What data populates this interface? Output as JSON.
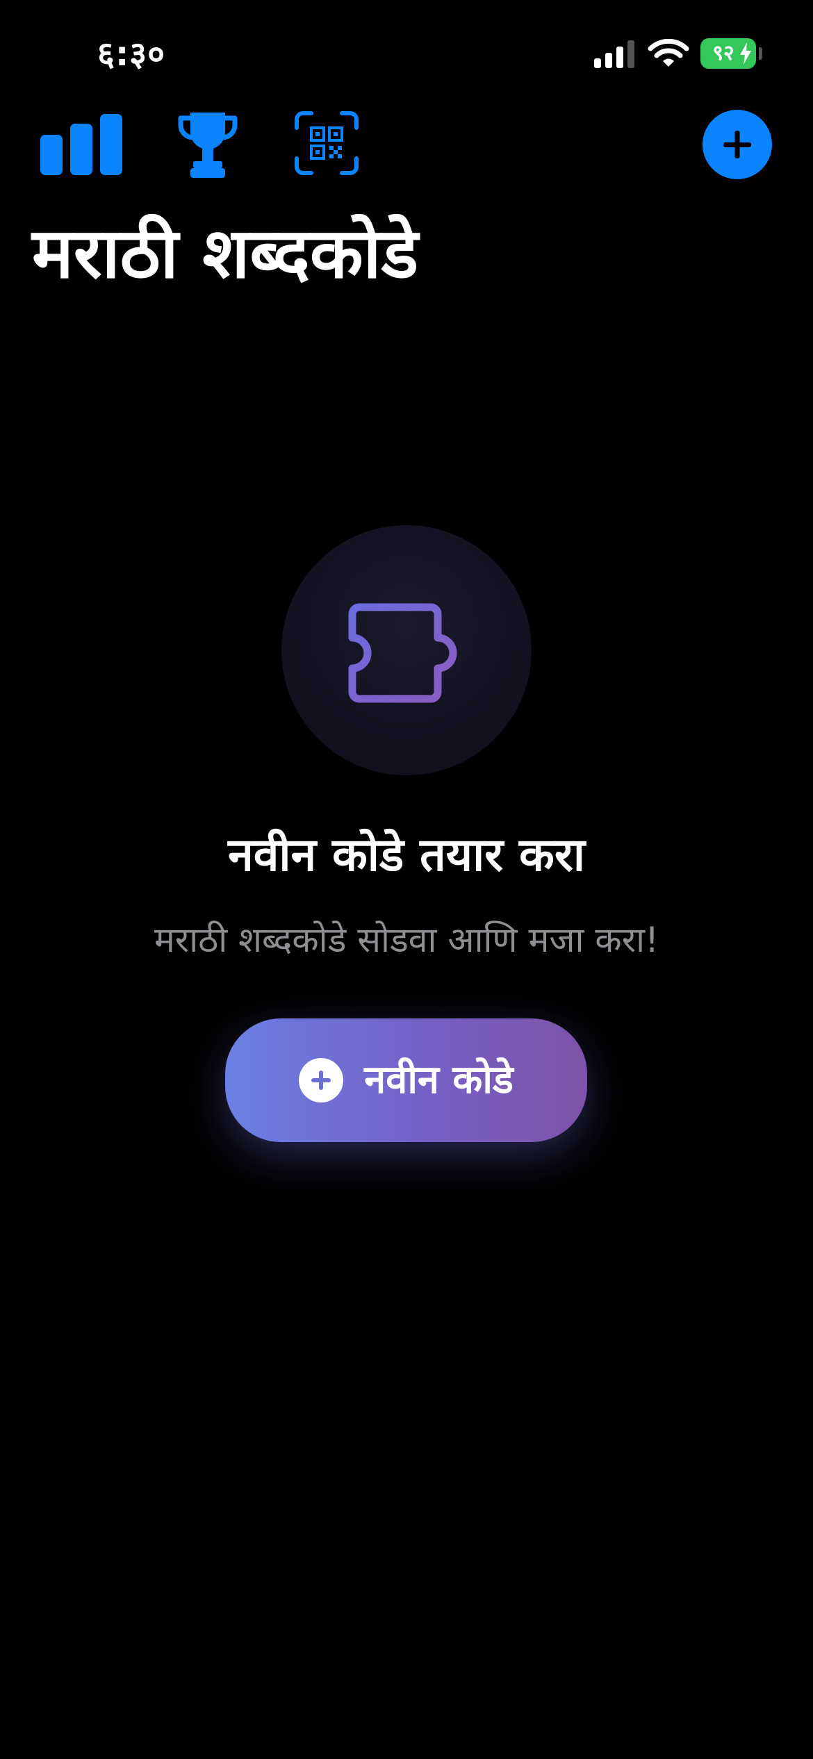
{
  "status_bar": {
    "time": "६:३०",
    "battery_level": "९२",
    "battery_color": "#34c759",
    "icons": [
      "signal-icon",
      "wifi-icon",
      "battery-icon"
    ]
  },
  "toolbar": {
    "accent_color": "#0a84ff",
    "icons": [
      "stats-icon",
      "trophy-icon",
      "qr-code-icon",
      "plus-icon"
    ]
  },
  "header": {
    "title": "मराठी शब्दकोडे"
  },
  "empty_state": {
    "icon": "puzzle-piece-icon",
    "heading": "नवीन कोडे तयार करा",
    "subtitle": "मराठी शब्दकोडे सोडवा आणि मजा करा!",
    "button_label": "नवीन कोडे",
    "button_gradient": [
      "#6b80e4",
      "#7463c9",
      "#7e52a8"
    ]
  }
}
